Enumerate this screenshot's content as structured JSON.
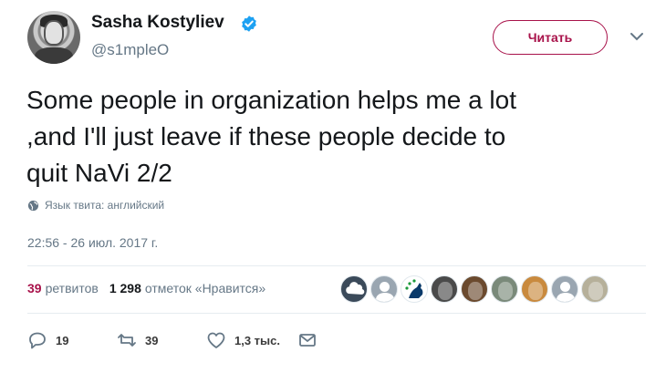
{
  "user": {
    "name": "Sasha Kostyliev",
    "handle": "@s1mpleO",
    "verified": true
  },
  "follow_button": {
    "label": "Читать"
  },
  "tweet": {
    "lines": [
      "Some people in organization helps me a lot",
      ",and I'll just leave if these people decide to",
      "quit NaVi 2/2"
    ],
    "language_note": "Язык твита: английский",
    "timestamp": "22:56 - 26 июл. 2017 г."
  },
  "stats": {
    "retweets_count": "39",
    "retweets_label": "ретвитов",
    "likes_count": "1 298",
    "likes_label": "отметок «Нравится»"
  },
  "actions": {
    "replies": "19",
    "retweets": "39",
    "likes": "1,3 тыс."
  },
  "colors": {
    "accent": "#a8124a",
    "verified": "#1da1f2",
    "muted": "#657786",
    "text": "#14171a"
  },
  "likers": [
    {
      "icon": "cloud9-avatar",
      "bg": "#3b4a5a"
    },
    {
      "icon": "default-avatar",
      "bg": "#9aa6b1"
    },
    {
      "icon": "team-liquid-avatar",
      "bg": "#ffffff"
    },
    {
      "icon": "photo-avatar",
      "bg": "#4a4a4a"
    },
    {
      "icon": "photo-avatar",
      "bg": "#6b4a2e"
    },
    {
      "icon": "photo-avatar",
      "bg": "#7a8a7a"
    },
    {
      "icon": "anime-avatar",
      "bg": "#c98a3e"
    },
    {
      "icon": "default-avatar",
      "bg": "#9aa6b1"
    },
    {
      "icon": "photo-avatar",
      "bg": "#b6b09a"
    }
  ]
}
